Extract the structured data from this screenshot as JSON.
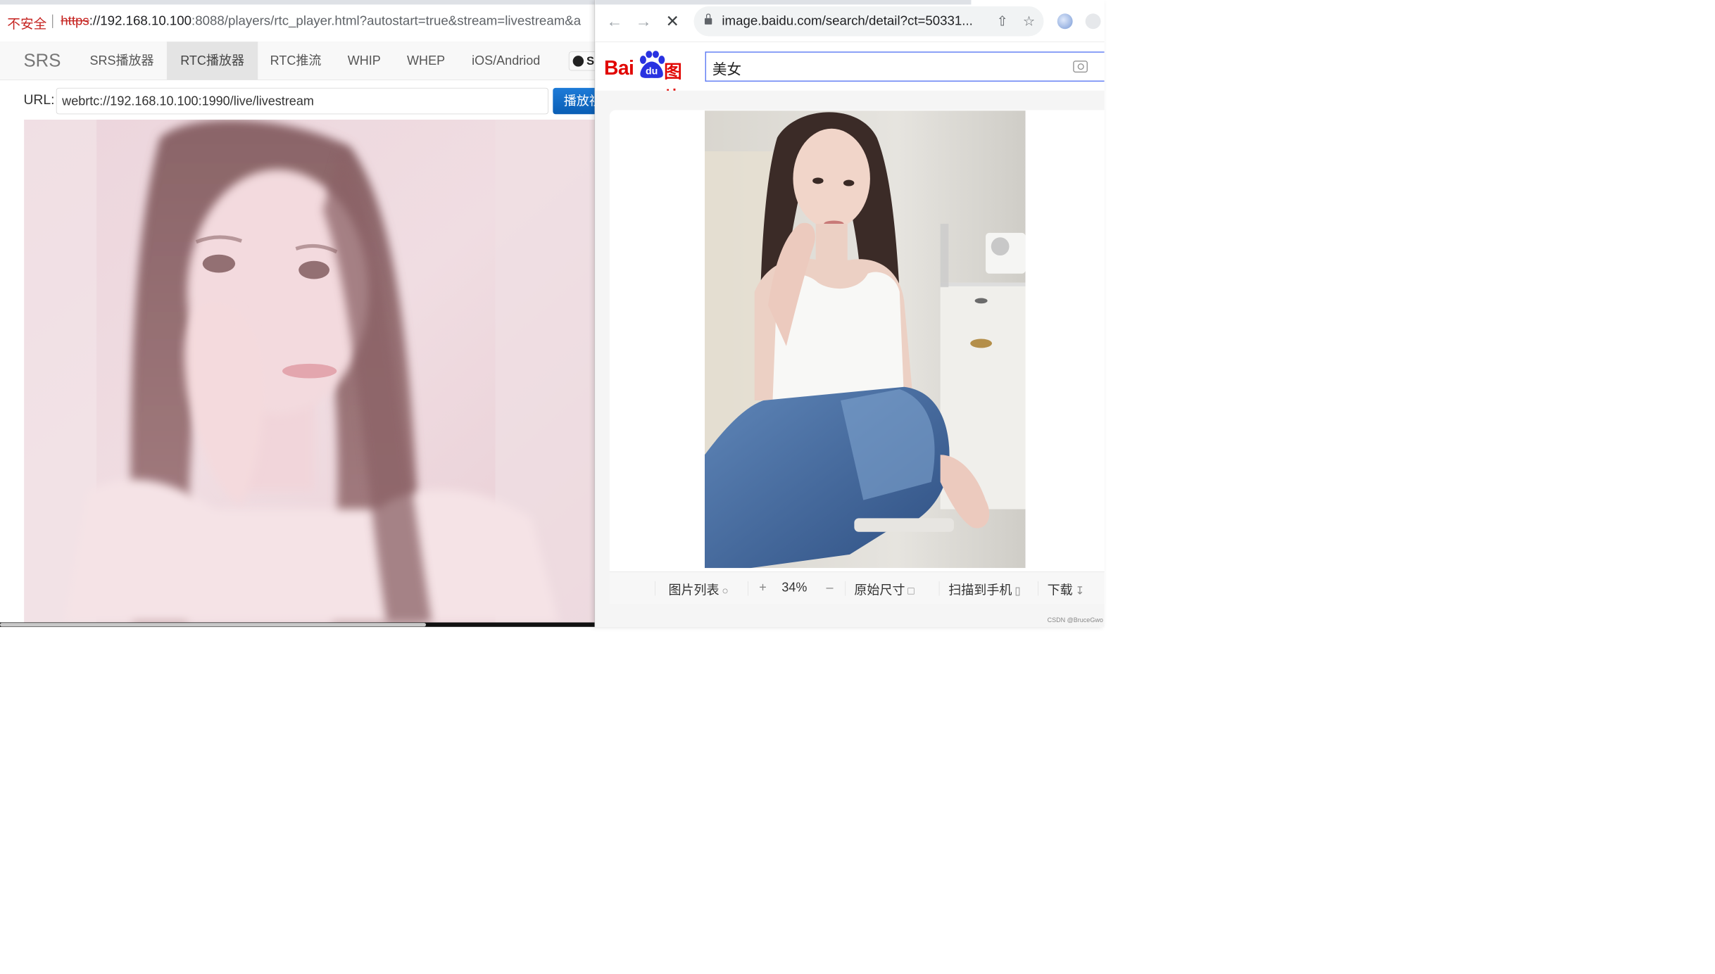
{
  "left": {
    "omnibox": {
      "security_label": "不安全",
      "url_scheme": "https",
      "url_host": "://192.168.10.100",
      "url_rest": ":8088/players/rtc_player.html?autostart=true&stream=livestream&a"
    },
    "nav": {
      "brand": "SRS",
      "items": [
        "SRS播放器",
        "RTC播放器",
        "RTC推流",
        "WHIP",
        "WHEP",
        "iOS/Andriod"
      ],
      "active_index": 1,
      "github_label": "S"
    },
    "url_label": "URL:",
    "url_value": "webrtc://192.168.10.100:1990/live/livestream",
    "play_button": "播放视"
  },
  "right": {
    "url": "image.baidu.com/search/detail?ct=50331...",
    "logo": {
      "bai": "Bai",
      "du": "du",
      "img": "图片"
    },
    "search_query": "美女",
    "toolbar": {
      "list": "图片列表",
      "zoom": "34%",
      "original": "原始尺寸",
      "scan": "扫描到手机",
      "download": "下载"
    },
    "watermark": "CSDN @BruceGwo"
  },
  "colors": {
    "insecure": "#c5221f",
    "baidu_red": "#e10602",
    "baidu_blue": "#2932e1",
    "play_button": "#0a5eb5"
  },
  "icons": [
    "back-arrow-icon",
    "forward-arrow-icon",
    "stop-loading-icon",
    "lock-icon",
    "share-icon",
    "star-icon",
    "camera-icon",
    "github-icon",
    "chevron-up-circle-icon",
    "plus-icon",
    "minus-icon",
    "fit-size-icon",
    "phone-icon",
    "download-icon"
  ]
}
